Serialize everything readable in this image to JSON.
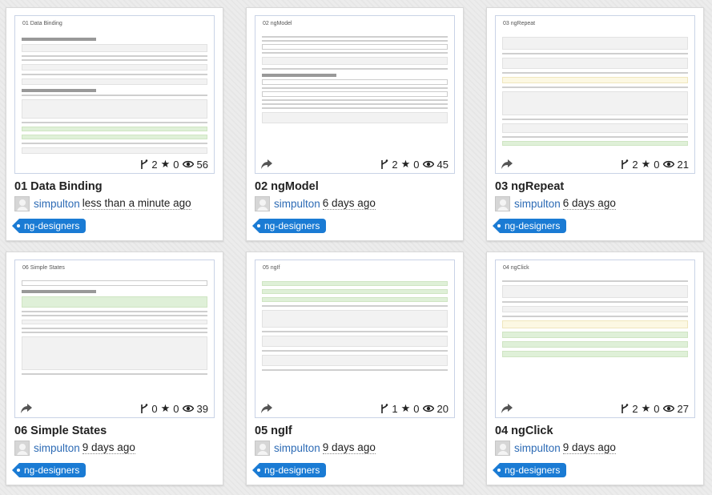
{
  "cards": [
    {
      "thumb_title": "01 Data Binding",
      "title": "01 Data Binding",
      "user": "simpulton",
      "time": "less than a minute ago",
      "tag": "ng-designers",
      "forks": "2",
      "stars": "0",
      "views": "56",
      "show_share": false
    },
    {
      "thumb_title": "02 ngModel",
      "title": "02 ngModel",
      "user": "simpulton",
      "time": "6 days ago",
      "tag": "ng-designers",
      "forks": "2",
      "stars": "0",
      "views": "45",
      "show_share": true
    },
    {
      "thumb_title": "03 ngRepeat",
      "title": "03 ngRepeat",
      "user": "simpulton",
      "time": "6 days ago",
      "tag": "ng-designers",
      "forks": "2",
      "stars": "0",
      "views": "21",
      "show_share": true
    },
    {
      "thumb_title": "06 Simple States",
      "title": "06 Simple States",
      "user": "simpulton",
      "time": "9 days ago",
      "tag": "ng-designers",
      "forks": "0",
      "stars": "0",
      "views": "39",
      "show_share": true
    },
    {
      "thumb_title": "05 ngIf",
      "title": "05 ngIf",
      "user": "simpulton",
      "time": "9 days ago",
      "tag": "ng-designers",
      "forks": "1",
      "stars": "0",
      "views": "20",
      "show_share": true
    },
    {
      "thumb_title": "04 ngClick",
      "title": "04 ngClick",
      "user": "simpulton",
      "time": "9 days ago",
      "tag": "ng-designers",
      "forks": "2",
      "stars": "0",
      "views": "27",
      "show_share": true
    }
  ],
  "icons": {
    "fork": "fork-icon",
    "star": "star-icon",
    "views": "eye-icon",
    "share": "share-arrow-icon",
    "avatar": "avatar"
  },
  "colors": {
    "link": "#2d6bb5",
    "tag_bg": "#1a7bd4",
    "thumb_border": "#c9d3e6"
  }
}
